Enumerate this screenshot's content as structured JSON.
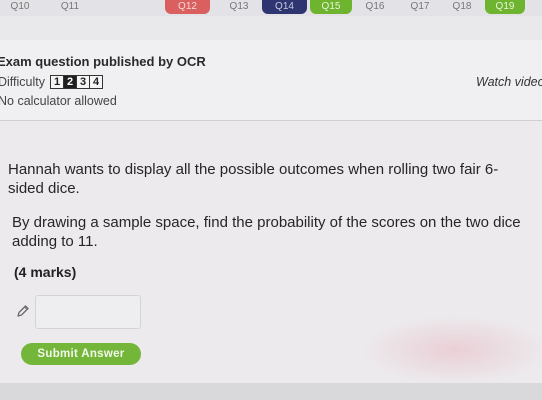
{
  "tabs": [
    {
      "label": "Q10",
      "style": "plain"
    },
    {
      "label": "Q11",
      "style": "plain"
    },
    {
      "label": "Q12",
      "style": "red"
    },
    {
      "label": "Q13",
      "style": "plain"
    },
    {
      "label": "Q14",
      "style": "navy"
    },
    {
      "label": "Q15",
      "style": "green"
    },
    {
      "label": "Q16",
      "style": "plain"
    },
    {
      "label": "Q17",
      "style": "plain"
    },
    {
      "label": "Q18",
      "style": "plain"
    },
    {
      "label": "Q19",
      "style": "green"
    }
  ],
  "header": {
    "exam_text": "Exam question published by OCR",
    "difficulty_label": "Difficulty",
    "difficulty_levels": [
      "1",
      "2",
      "3",
      "4"
    ],
    "difficulty_active": "2",
    "calculator_text": "No calculator allowed",
    "watch_video": "Watch video"
  },
  "question": {
    "paragraph1": "Hannah wants to display all the possible outcomes when rolling two fair 6-sided dice.",
    "paragraph2": "By drawing a sample space, find the probability of the scores on the two dice adding to 11.",
    "marks": "(4 marks)"
  },
  "answer": {
    "value": "",
    "submit_label": "Submit Answer"
  },
  "colors": {
    "accent_green": "#74b63a",
    "tab_red": "#d9605f",
    "tab_navy": "#2e3570"
  },
  "icons": [
    "pencil-icon"
  ]
}
